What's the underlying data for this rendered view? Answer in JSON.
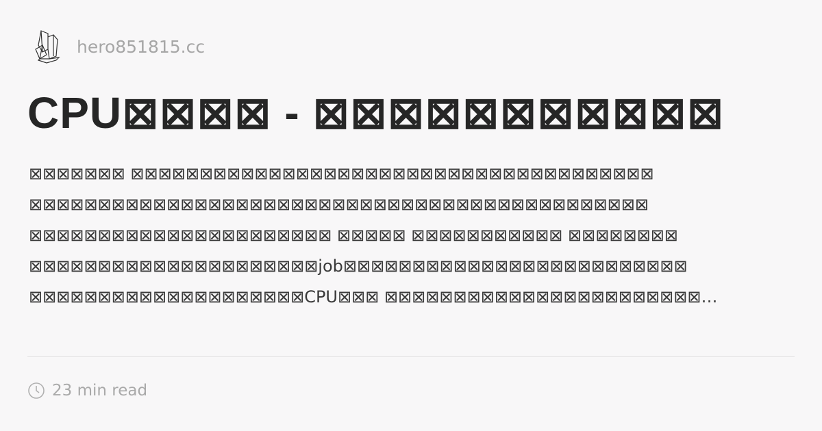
{
  "site": {
    "name": "hero851815.cc",
    "logo_icon": "crystal-icon"
  },
  "title": "CPU⊠⊠⊠⊠ - ⊠⊠⊠⊠⊠⊠⊠⊠⊠⊠⊠",
  "description_lines": [
    "⊠⊠⊠⊠⊠⊠⊠ ⊠⊠⊠⊠⊠⊠⊠⊠⊠⊠⊠⊠⊠⊠⊠⊠⊠⊠⊠⊠⊠⊠⊠⊠⊠⊠⊠⊠⊠⊠⊠⊠⊠⊠⊠⊠⊠⊠",
    "⊠⊠⊠⊠⊠⊠⊠⊠⊠⊠⊠⊠⊠⊠⊠⊠⊠⊠⊠⊠⊠⊠⊠⊠⊠⊠⊠⊠⊠⊠⊠⊠⊠⊠⊠⊠⊠⊠⊠⊠⊠⊠⊠⊠⊠",
    "⊠⊠⊠⊠⊠⊠⊠⊠⊠⊠⊠⊠⊠⊠⊠⊠⊠⊠⊠⊠⊠⊠ ⊠⊠⊠⊠⊠ ⊠⊠⊠⊠⊠⊠⊠⊠⊠⊠⊠ ⊠⊠⊠⊠⊠⊠⊠⊠",
    "⊠⊠⊠⊠⊠⊠⊠⊠⊠⊠⊠⊠⊠⊠⊠⊠⊠⊠⊠⊠⊠job⊠⊠⊠⊠⊠⊠⊠⊠⊠⊠⊠⊠⊠⊠⊠⊠⊠⊠⊠⊠⊠⊠⊠⊠⊠",
    "⊠⊠⊠⊠⊠⊠⊠⊠⊠⊠⊠⊠⊠⊠⊠⊠⊠⊠⊠⊠CPU⊠⊠⊠ ⊠⊠⊠⊠⊠⊠⊠⊠⊠⊠⊠⊠⊠⊠⊠⊠⊠⊠⊠⊠⊠⊠⊠…"
  ],
  "meta": {
    "read_time": "23 min read",
    "clock_icon": "clock-icon"
  }
}
